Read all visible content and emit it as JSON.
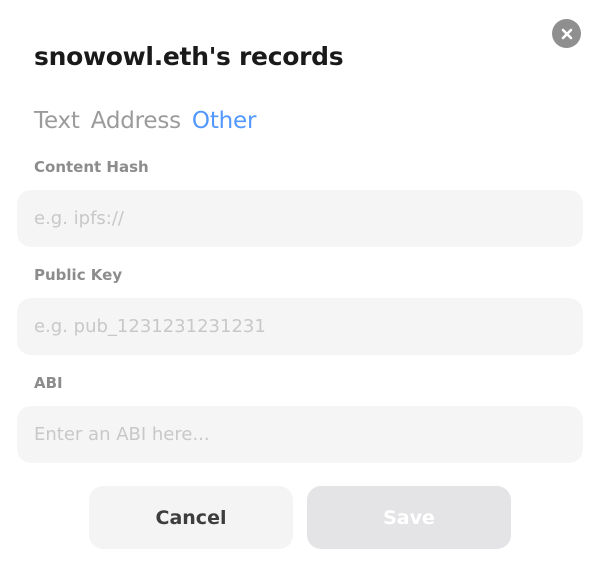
{
  "modal": {
    "title": "snowowl.eth's records",
    "close_icon": "close-icon"
  },
  "tabs": [
    {
      "label": "Text",
      "active": false
    },
    {
      "label": "Address",
      "active": false
    },
    {
      "label": "Other",
      "active": true
    }
  ],
  "fields": {
    "content_hash": {
      "label": "Content Hash",
      "placeholder": "e.g. ipfs://",
      "value": ""
    },
    "public_key": {
      "label": "Public Key",
      "placeholder": "e.g. pub_1231231231231",
      "value": ""
    },
    "abi": {
      "label": "ABI",
      "placeholder": "Enter an ABI here...",
      "value": ""
    }
  },
  "actions": {
    "cancel_label": "Cancel",
    "save_label": "Save"
  },
  "colors": {
    "accent": "#5298ff",
    "tab_inactive": "#9b9b9b",
    "input_bg": "#f5f5f6",
    "save_disabled_bg": "#e4e4e6"
  }
}
